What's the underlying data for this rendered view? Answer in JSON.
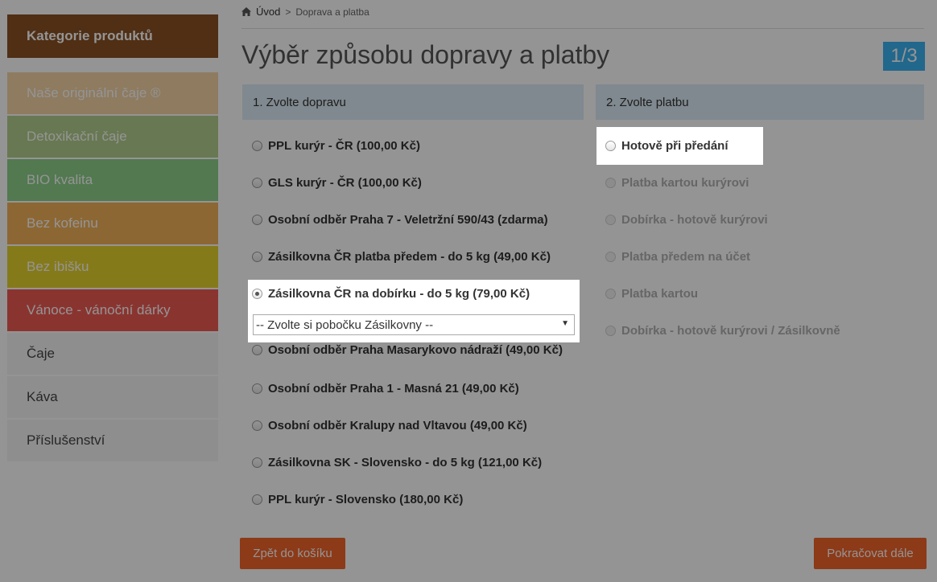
{
  "sidebar": {
    "header": "Kategorie produktů",
    "items": [
      {
        "label": "Naše originální čaje ®",
        "color": "#f5d5a6"
      },
      {
        "label": "Detoxikační čaje",
        "color": "#b4cf8d"
      },
      {
        "label": "BIO kvalita",
        "color": "#8ed08a"
      },
      {
        "label": "Bez kofeinu",
        "color": "#f2b25a"
      },
      {
        "label": "Bez ibišku",
        "color": "#e6d22e"
      },
      {
        "label": "Vánoce - vánoční dárky",
        "color": "#ee5a54"
      },
      {
        "label": "Čaje",
        "color": "#f5f5f5"
      },
      {
        "label": "Káva",
        "color": "#f5f5f5"
      },
      {
        "label": "Příslušenství",
        "color": "#f5f5f5"
      }
    ]
  },
  "breadcrumb": {
    "home": "Úvod",
    "separator": ">",
    "current": "Doprava a platba"
  },
  "page_title": "Výběr způsobu dopravy a platby",
  "step": "1/3",
  "shipping": {
    "heading": "1. Zvolte dopravu",
    "options": [
      {
        "label": "PPL kurýr - ČR (100,00 Kč)",
        "checked": false
      },
      {
        "label": "GLS kurýr - ČR (100,00 Kč)",
        "checked": false
      },
      {
        "label": "Osobní odběr Praha 7 - Veletržní 590/43 (zdarma)",
        "checked": false
      },
      {
        "label": "Zásilkovna ČR platba předem - do 5 kg (49,00 Kč)",
        "checked": false
      },
      {
        "label": "Zásilkovna ČR na dobírku - do 5 kg (79,00 Kč)",
        "checked": true
      },
      {
        "label": "Osobní odběr Praha Masarykovo nádraží (49,00 Kč)",
        "checked": false
      },
      {
        "label": "Osobní odběr Praha 1 - Masná 21 (49,00 Kč)",
        "checked": false
      },
      {
        "label": "Osobní odběr Kralupy nad Vltavou (49,00 Kč)",
        "checked": false
      },
      {
        "label": "Zásilkovna SK - Slovensko - do 5 kg (121,00 Kč)",
        "checked": false
      },
      {
        "label": "PPL kurýr - Slovensko (180,00 Kč)",
        "checked": false
      }
    ],
    "branch_select": "-- Zvolte si pobočku Zásilkovny --"
  },
  "payment": {
    "heading": "2. Zvolte platbu",
    "options": [
      {
        "label": "Hotově při předání",
        "disabled": false
      },
      {
        "label": "Platba kartou kurýrovi",
        "disabled": true
      },
      {
        "label": "Dobírka - hotově kurýrovi",
        "disabled": true
      },
      {
        "label": "Platba předem na účet",
        "disabled": true
      },
      {
        "label": "Platba kartou",
        "disabled": true
      },
      {
        "label": "Dobírka - hotově kurýrovi / Zásilkovně",
        "disabled": true
      }
    ]
  },
  "buttons": {
    "back": "Zpět do košíku",
    "next": "Pokračovat dále"
  },
  "colors": {
    "brand_brown": "#8a5225",
    "accent_orange": "#f2642a",
    "step_blue": "#3bb1f2",
    "column_header": "#dcecf7"
  }
}
